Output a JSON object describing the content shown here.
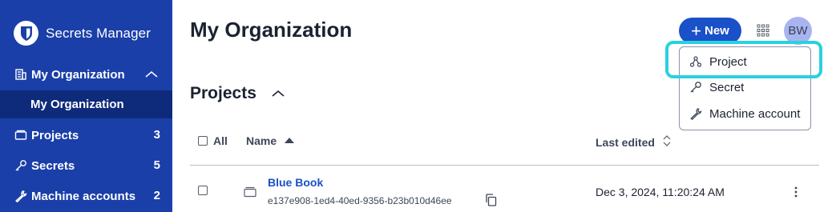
{
  "sidebar": {
    "brand_name": "Secrets Manager",
    "org_name": "My Organization",
    "org_sub": "My Organization",
    "items": [
      {
        "label": "Projects",
        "count": "3",
        "icon": "project-icon"
      },
      {
        "label": "Secrets",
        "count": "5",
        "icon": "key-icon"
      },
      {
        "label": "Machine accounts",
        "count": "2",
        "icon": "wrench-icon"
      }
    ],
    "bg_color": "#1a3fa8"
  },
  "header": {
    "title": "My Organization",
    "new_label": "New",
    "avatar_initials": "BW"
  },
  "new_menu": {
    "items": [
      {
        "label": "Project",
        "icon": "project-icon"
      },
      {
        "label": "Secret",
        "icon": "key-icon"
      },
      {
        "label": "Machine account",
        "icon": "wrench-icon"
      }
    ],
    "highlight_color": "#2ad1de"
  },
  "projects_section": {
    "title": "Projects",
    "columns": {
      "all": "All",
      "name": "Name",
      "last_edited": "Last edited"
    },
    "rows": [
      {
        "name": "Blue Book",
        "id": "e137e908-1ed4-40ed-9356-b23b010d46ee",
        "last_edited": "Dec 3, 2024, 11:20:24 AM"
      }
    ]
  }
}
